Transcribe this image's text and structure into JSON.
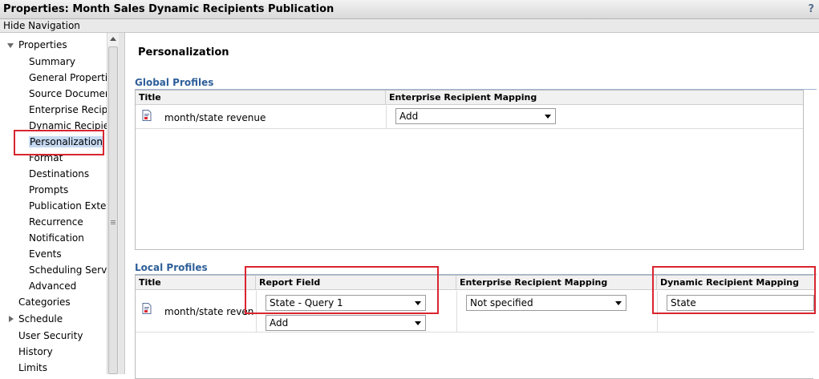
{
  "window": {
    "title": "Properties: Month Sales Dynamic Recipients Publication",
    "help": "?"
  },
  "hide_navigation": "Hide Navigation",
  "nav": {
    "root": "Properties",
    "children": [
      "Summary",
      "General Properties",
      "Source Documents",
      "Enterprise Recipients",
      "Dynamic Recipients",
      "Personalization",
      "Format",
      "Destinations",
      "Prompts",
      "Publication Extensions",
      "Recurrence",
      "Notification",
      "Events",
      "Scheduling Server",
      "Advanced"
    ],
    "selected": "Personalization",
    "top_items": [
      "Categories",
      "Schedule",
      "User Security",
      "History",
      "Limits"
    ]
  },
  "page": {
    "heading": "Personalization"
  },
  "global_profiles": {
    "title": "Global Profiles",
    "columns": [
      "Title",
      "Enterprise Recipient Mapping"
    ],
    "rows": [
      {
        "title": "month/state revenue",
        "mapping": "Add"
      }
    ]
  },
  "local_profiles": {
    "title": "Local Profiles",
    "columns": [
      "Title",
      "Report Field",
      "Enterprise Recipient Mapping",
      "Dynamic Recipient Mapping"
    ],
    "rows": [
      {
        "title": "month/state revenue",
        "report_field": "State - Query 1",
        "report_field_add": "Add",
        "enterprise_mapping": "Not specified",
        "dynamic_mapping": "State"
      }
    ]
  },
  "colors": {
    "highlight": "#d9252f",
    "section_title": "#2e5f99",
    "selection": "#c5d9f1"
  }
}
